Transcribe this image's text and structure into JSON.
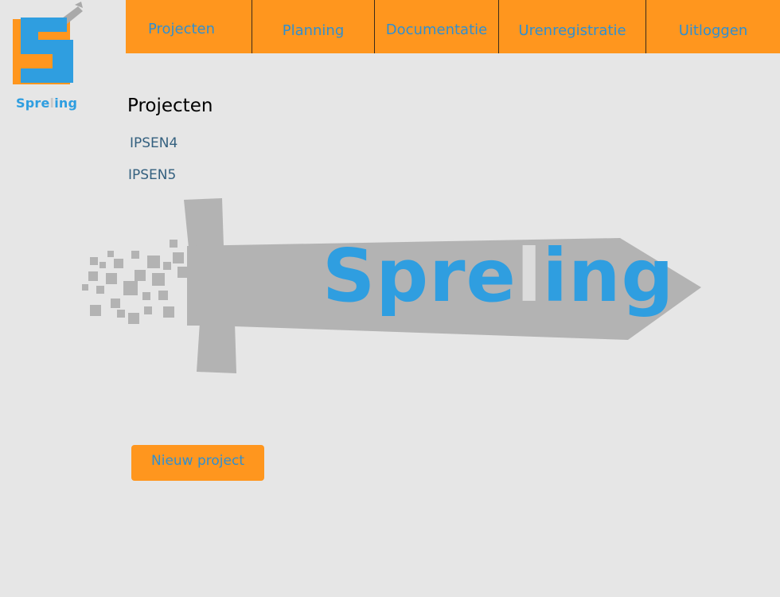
{
  "brand": {
    "name_pre": "Spre",
    "name_mid": "l",
    "name_post": "ing",
    "primary_color": "#2f9ee0",
    "accent_color": "#ff961e"
  },
  "nav": {
    "items": [
      {
        "label": "Projecten"
      },
      {
        "label": "Planning"
      },
      {
        "label": "Documentatie"
      },
      {
        "label": "Urenregistratie"
      },
      {
        "label": "Uitloggen"
      }
    ]
  },
  "main": {
    "title": "Projecten",
    "projects": [
      {
        "name": "IPSEN4"
      },
      {
        "name": "IPSEN5"
      }
    ],
    "new_project_label": "Nieuw project"
  },
  "banner": {
    "text_pre": "Spre",
    "text_mid": "l",
    "text_post": "ing",
    "icon": "sword-pixel-icon"
  }
}
